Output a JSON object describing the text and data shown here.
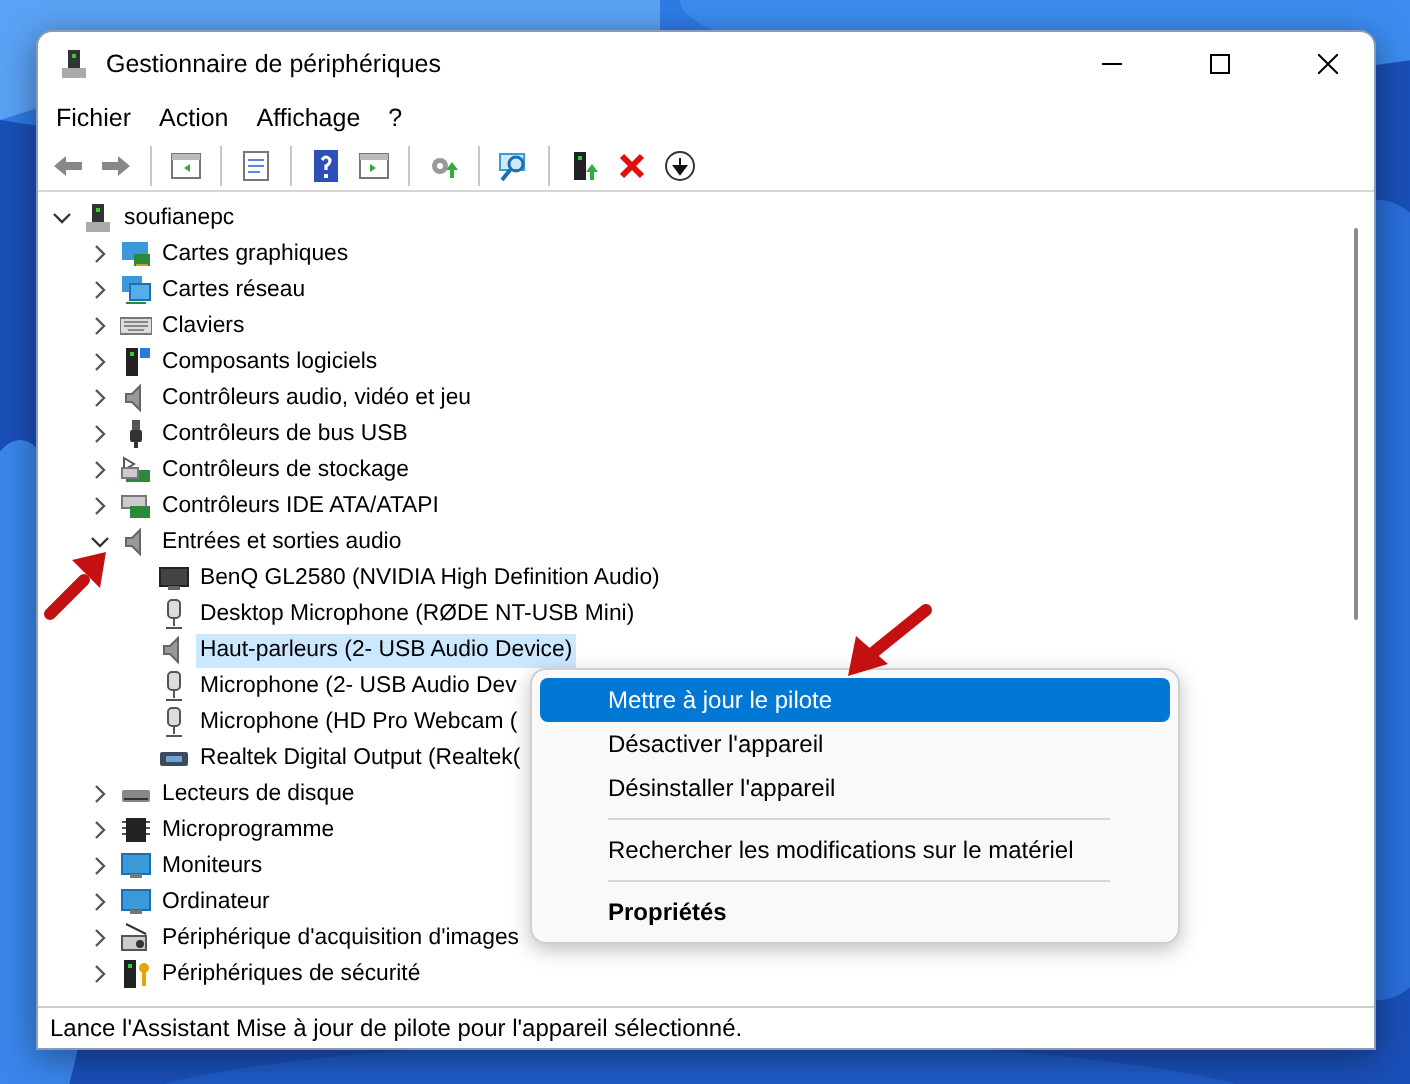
{
  "window": {
    "title": "Gestionnaire de périphériques"
  },
  "menu_bar": [
    "Fichier",
    "Action",
    "Affichage",
    "?"
  ],
  "toolbar": [
    {
      "kind": "back"
    },
    {
      "kind": "forward"
    },
    {
      "kind": "sep"
    },
    {
      "kind": "panel"
    },
    {
      "kind": "sep"
    },
    {
      "kind": "properties"
    },
    {
      "kind": "sep"
    },
    {
      "kind": "help"
    },
    {
      "kind": "panel-run"
    },
    {
      "kind": "sep"
    },
    {
      "kind": "update"
    },
    {
      "kind": "sep"
    },
    {
      "kind": "scan"
    },
    {
      "kind": "sep"
    },
    {
      "kind": "enable"
    },
    {
      "kind": "uninstall"
    },
    {
      "kind": "disable"
    }
  ],
  "tree": {
    "label": "soufianepc",
    "kind": "computer-tower",
    "expanded": true,
    "selected": false,
    "children": [
      {
        "label": "Cartes graphiques",
        "kind": "display",
        "expanded": false,
        "selected": false
      },
      {
        "label": "Cartes réseau",
        "kind": "network",
        "expanded": false,
        "selected": false
      },
      {
        "label": "Claviers",
        "kind": "keyboard",
        "expanded": false,
        "selected": false
      },
      {
        "label": "Composants logiciels",
        "kind": "software",
        "expanded": false,
        "selected": false
      },
      {
        "label": "Contrôleurs audio, vidéo et jeu",
        "kind": "speaker",
        "expanded": false,
        "selected": false
      },
      {
        "label": "Contrôleurs de bus USB",
        "kind": "usb",
        "expanded": false,
        "selected": false
      },
      {
        "label": "Contrôleurs de stockage",
        "kind": "storage",
        "expanded": false,
        "selected": false
      },
      {
        "label": "Contrôleurs IDE ATA/ATAPI",
        "kind": "ide",
        "expanded": false,
        "selected": false
      },
      {
        "label": "Entrées et sorties audio",
        "kind": "speaker",
        "expanded": true,
        "selected": false,
        "children": [
          {
            "label": "BenQ GL2580 (NVIDIA High Definition Audio)",
            "kind": "screen",
            "selected": false
          },
          {
            "label": "Desktop Microphone (RØDE NT-USB Mini)",
            "kind": "mic",
            "selected": false
          },
          {
            "label": "Haut-parleurs (2- USB Audio Device)",
            "kind": "speaker",
            "selected": true
          },
          {
            "label": "Microphone (2- USB Audio Dev",
            "kind": "mic",
            "selected": false
          },
          {
            "label": "Microphone (HD Pro Webcam (",
            "kind": "mic",
            "selected": false
          },
          {
            "label": "Realtek Digital Output (Realtek(",
            "kind": "digital-out",
            "selected": false
          }
        ]
      },
      {
        "label": "Lecteurs de disque",
        "kind": "disk",
        "expanded": false,
        "selected": false
      },
      {
        "label": "Microprogramme",
        "kind": "chip",
        "expanded": false,
        "selected": false
      },
      {
        "label": "Moniteurs",
        "kind": "monitor",
        "expanded": false,
        "selected": false
      },
      {
        "label": "Ordinateur",
        "kind": "monitor",
        "expanded": false,
        "selected": false
      },
      {
        "label": "Périphérique d'acquisition d'images",
        "kind": "camera",
        "expanded": false,
        "selected": false
      },
      {
        "label": "Périphériques de sécurité",
        "kind": "security",
        "expanded": false,
        "selected": false
      }
    ]
  },
  "context_menu": [
    {
      "kind": "item",
      "label": "Mettre à jour le pilote",
      "selected": true,
      "default": false
    },
    {
      "kind": "item",
      "label": "Désactiver l'appareil",
      "selected": false,
      "default": false
    },
    {
      "kind": "item",
      "label": "Désinstaller l'appareil",
      "selected": false,
      "default": false
    },
    {
      "kind": "separator"
    },
    {
      "kind": "item",
      "label": "Rechercher les modifications sur le matériel",
      "selected": false,
      "default": false
    },
    {
      "kind": "separator"
    },
    {
      "kind": "item",
      "label": "Propriétés",
      "selected": false,
      "default": true
    }
  ],
  "status_bar": "Lance l'Assistant Mise à jour de pilote pour l'appareil sélectionné."
}
